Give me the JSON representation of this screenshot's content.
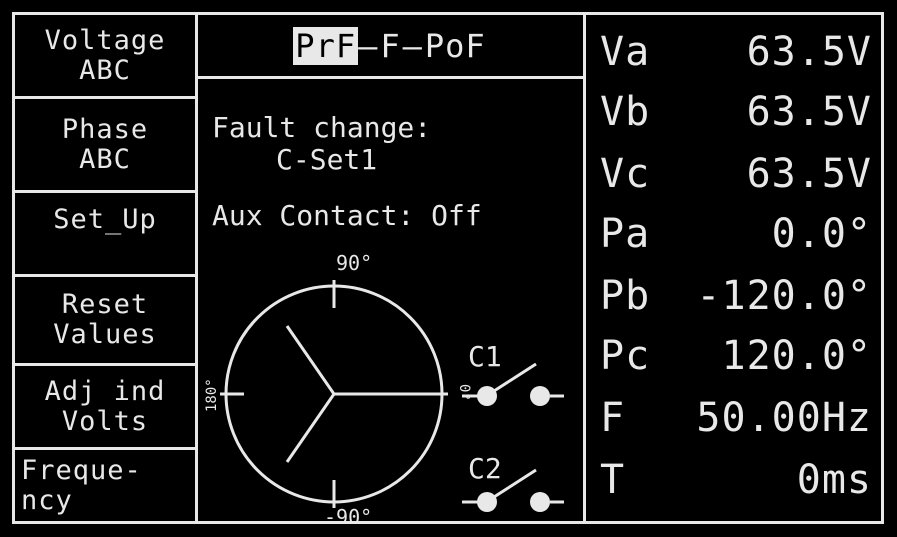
{
  "softkeys": [
    {
      "line1": "Voltage",
      "line2": "ABC"
    },
    {
      "line1": "Phase",
      "line2": "ABC"
    },
    {
      "line1": "Set_Up",
      "line2": ""
    },
    {
      "line1": "Reset",
      "line2": "Values"
    },
    {
      "line1": "Adj ind",
      "line2": "Volts"
    },
    {
      "line1": "Freque-",
      "line2": "ncy"
    }
  ],
  "tabs": {
    "prefault": "PrF",
    "fault": "F",
    "postfault": "PoF",
    "separator": "—",
    "active": "prefault"
  },
  "status": {
    "fault_change_label": "Fault change:",
    "fault_change_value": "C-Set1",
    "aux_contact": "Aux Contact: Off"
  },
  "phasor": {
    "top_label": "90°",
    "bottom_label": "-90°",
    "left_label": "180°",
    "right_label": "0°"
  },
  "contacts": {
    "c1": "C1",
    "c2": "C2"
  },
  "readings": [
    {
      "label": "Va",
      "value": "63.5V"
    },
    {
      "label": "Vb",
      "value": "63.5V"
    },
    {
      "label": "Vc",
      "value": "63.5V"
    },
    {
      "label": "Pa",
      "value": "0.0°"
    },
    {
      "label": "Pb",
      "value": "-120.0°"
    },
    {
      "label": "Pc",
      "value": "120.0°"
    },
    {
      "label": "F",
      "value": "50.00Hz"
    },
    {
      "label": "T",
      "value": "0ms"
    }
  ],
  "colors": {
    "background": "#000000",
    "foreground": "#e8e8e8"
  }
}
